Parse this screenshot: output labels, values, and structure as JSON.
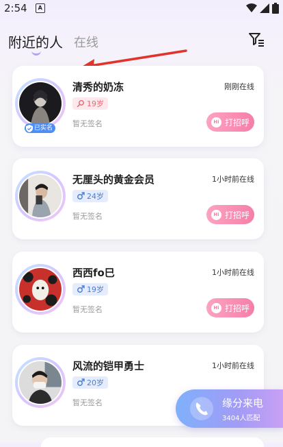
{
  "status_bar": {
    "time": "2:54",
    "app_icon_letter": "A"
  },
  "header": {
    "tabs": [
      {
        "label": "附近的人",
        "active": true
      },
      {
        "label": "在线",
        "active": false
      }
    ],
    "filter_icon": "filter-icon"
  },
  "users": [
    {
      "name": "清秀的奶冻",
      "gender": "female",
      "age": "19岁",
      "signature": "暂无签名",
      "last_online": "刚刚在线",
      "verified": true,
      "verified_label": "已实名",
      "greet_label": "打招呼"
    },
    {
      "name": "无厘头的黄金会员",
      "gender": "male",
      "age": "24岁",
      "signature": "暂无签名",
      "last_online": "1小时前在线",
      "verified": false,
      "greet_label": "打招呼"
    },
    {
      "name": "西西fo巳",
      "gender": "male",
      "age": "19岁",
      "signature": "暂无签名",
      "last_online": "1小时前在线",
      "verified": false,
      "greet_label": "打招呼"
    },
    {
      "name": "风流的铠甲勇士",
      "gender": "male",
      "age": "20岁",
      "signature": "暂无签名",
      "last_online": "1小时前在线",
      "verified": false,
      "greet_label": "打招呼"
    }
  ],
  "fate_call": {
    "title": "缘分来电",
    "subtitle": "3404人匹配"
  },
  "colors": {
    "accent_pink": "#f67ea8",
    "female_tag": "#e46a79",
    "male_tag": "#4b7ed6",
    "verified": "#4d8df5",
    "arrow": "#e0342b"
  }
}
